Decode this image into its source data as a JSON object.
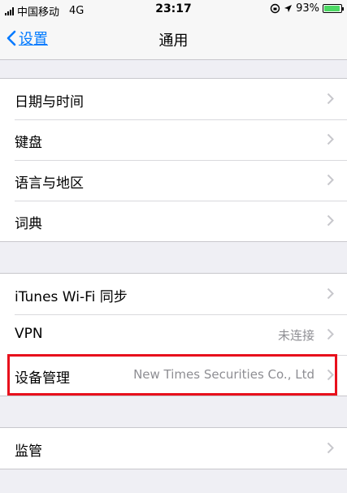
{
  "status_bar": {
    "carrier": "中国移动",
    "network": "4G",
    "time": "23:17",
    "battery": "93%",
    "battery_level": 0.93
  },
  "nav": {
    "back_label": "设置",
    "title": "通用"
  },
  "group1": [
    {
      "label": "日期与时间"
    },
    {
      "label": "键盘"
    },
    {
      "label": "语言与地区"
    },
    {
      "label": "词典"
    }
  ],
  "group2": [
    {
      "label": "iTunes Wi-Fi 同步",
      "value": ""
    },
    {
      "label": "VPN",
      "value": "未连接"
    },
    {
      "label": "设备管理",
      "value": "New Times Securities Co., Ltd"
    }
  ],
  "group3": [
    {
      "label": "监管"
    }
  ],
  "colors": {
    "accent": "#007aff",
    "highlight_border": "#e8101c",
    "battery": "#4cd964"
  }
}
